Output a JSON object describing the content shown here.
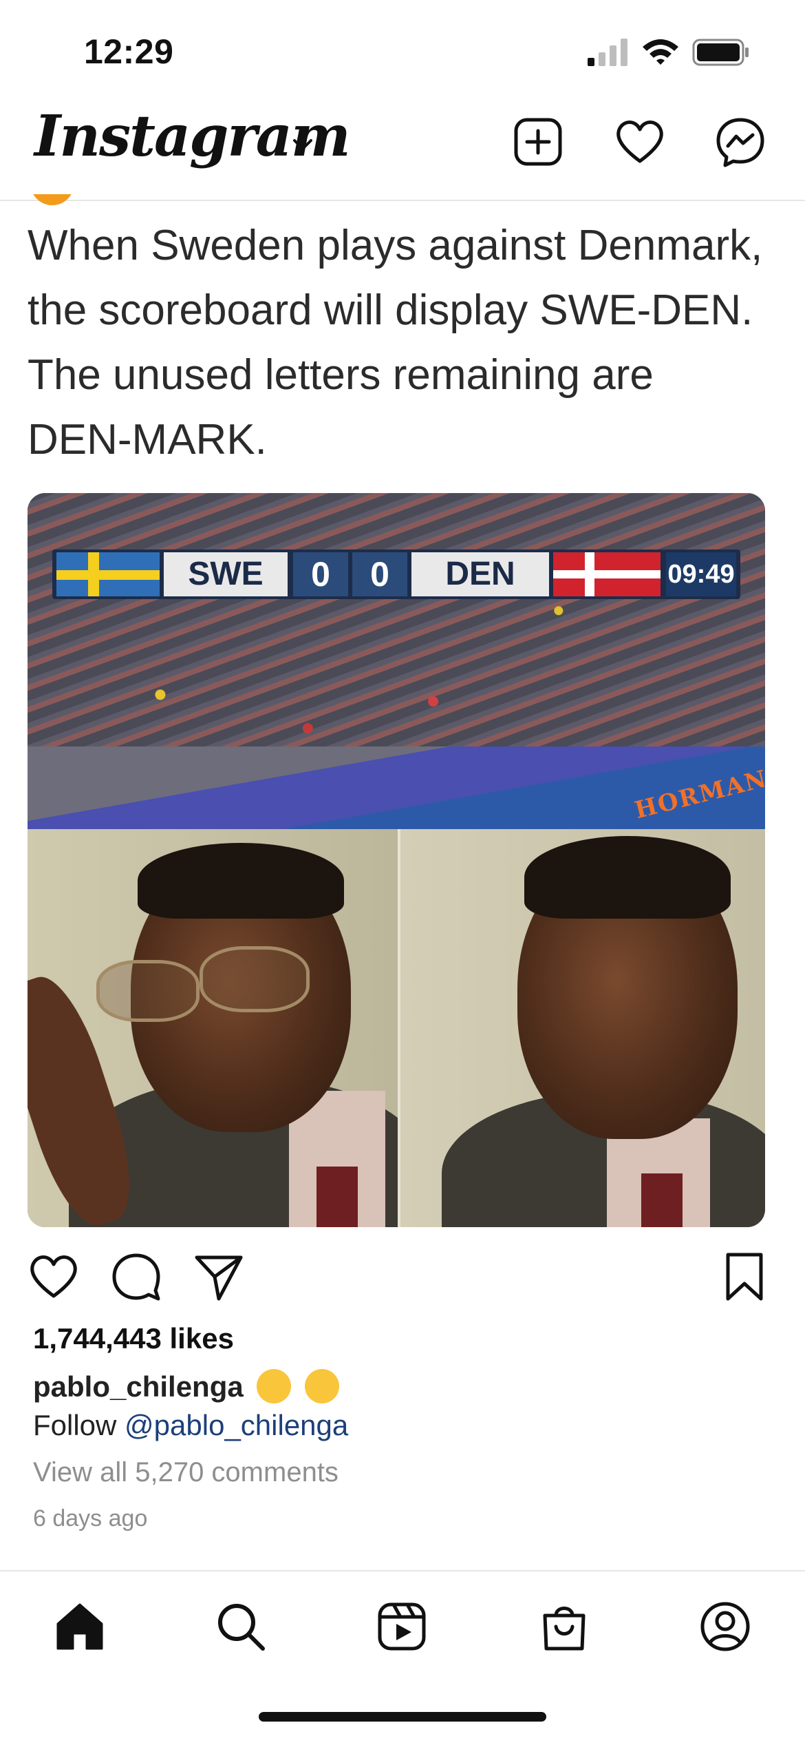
{
  "status_bar": {
    "time": "12:29"
  },
  "header": {
    "logo_text": "Instagram"
  },
  "post": {
    "text_lines": [
      "When Sweden plays against Denmark,",
      "the scoreboard will display SWE-DEN.",
      "The unused letters remaining are",
      "DEN-MARK."
    ],
    "scoreboard": {
      "home_team": "SWE",
      "home_score": "0",
      "away_score": "0",
      "away_team": "DEN",
      "clock": "09:49"
    },
    "stadium_board_text": "HORMANN",
    "likes": "1,744,443 likes",
    "caption_user": "pablo_chilenga",
    "follow_prefix": "Follow",
    "follow_handle": "@pablo_chilenga",
    "view_all_comments": "View all 5,270 comments",
    "posted_ago": "6 days ago"
  },
  "icons": {
    "header": [
      "plus-square-icon",
      "heart-icon",
      "messenger-icon"
    ],
    "actions": [
      "heart-icon",
      "comment-icon",
      "share-icon",
      "bookmark-icon"
    ],
    "tabs": [
      "home-icon",
      "search-icon",
      "reels-icon",
      "shop-icon",
      "profile-icon"
    ]
  }
}
